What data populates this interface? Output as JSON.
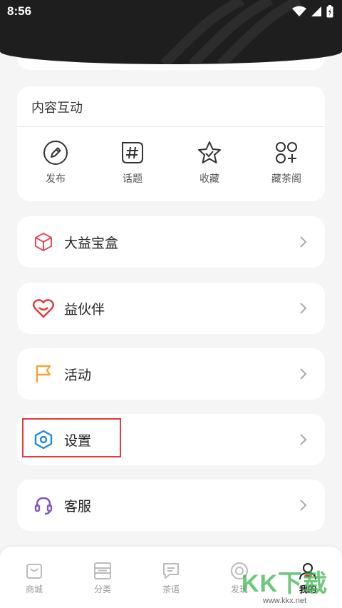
{
  "status_bar": {
    "time": "8:56"
  },
  "content_card": {
    "title": "内容互动",
    "items": [
      {
        "label": "发布",
        "icon": "pencil-icon"
      },
      {
        "label": "话题",
        "icon": "hashtag-icon"
      },
      {
        "label": "收藏",
        "icon": "star-icon"
      },
      {
        "label": "藏茶阁",
        "icon": "circles-plus-icon"
      }
    ]
  },
  "menu": [
    {
      "label": "大益宝盒",
      "icon": "box-icon",
      "color": "#e84a5f"
    },
    {
      "label": "益伙伴",
      "icon": "heart-icon",
      "color": "#e53935"
    },
    {
      "label": "活动",
      "icon": "flag-icon",
      "color": "#f5a33a"
    },
    {
      "label": "设置",
      "icon": "hexagon-settings-icon",
      "color": "#1e88e5"
    },
    {
      "label": "客服",
      "icon": "headset-icon",
      "color": "#7e57c2"
    }
  ],
  "bottom_nav": [
    {
      "label": "商城",
      "icon": "bag-icon"
    },
    {
      "label": "分类",
      "icon": "category-icon"
    },
    {
      "label": "茶语",
      "icon": "message-icon"
    },
    {
      "label": "发现",
      "icon": "eye-icon"
    },
    {
      "label": "我的",
      "icon": "user-icon",
      "active": true
    }
  ],
  "watermark": {
    "main": "KK下载",
    "sub": "www.kkx.net"
  }
}
